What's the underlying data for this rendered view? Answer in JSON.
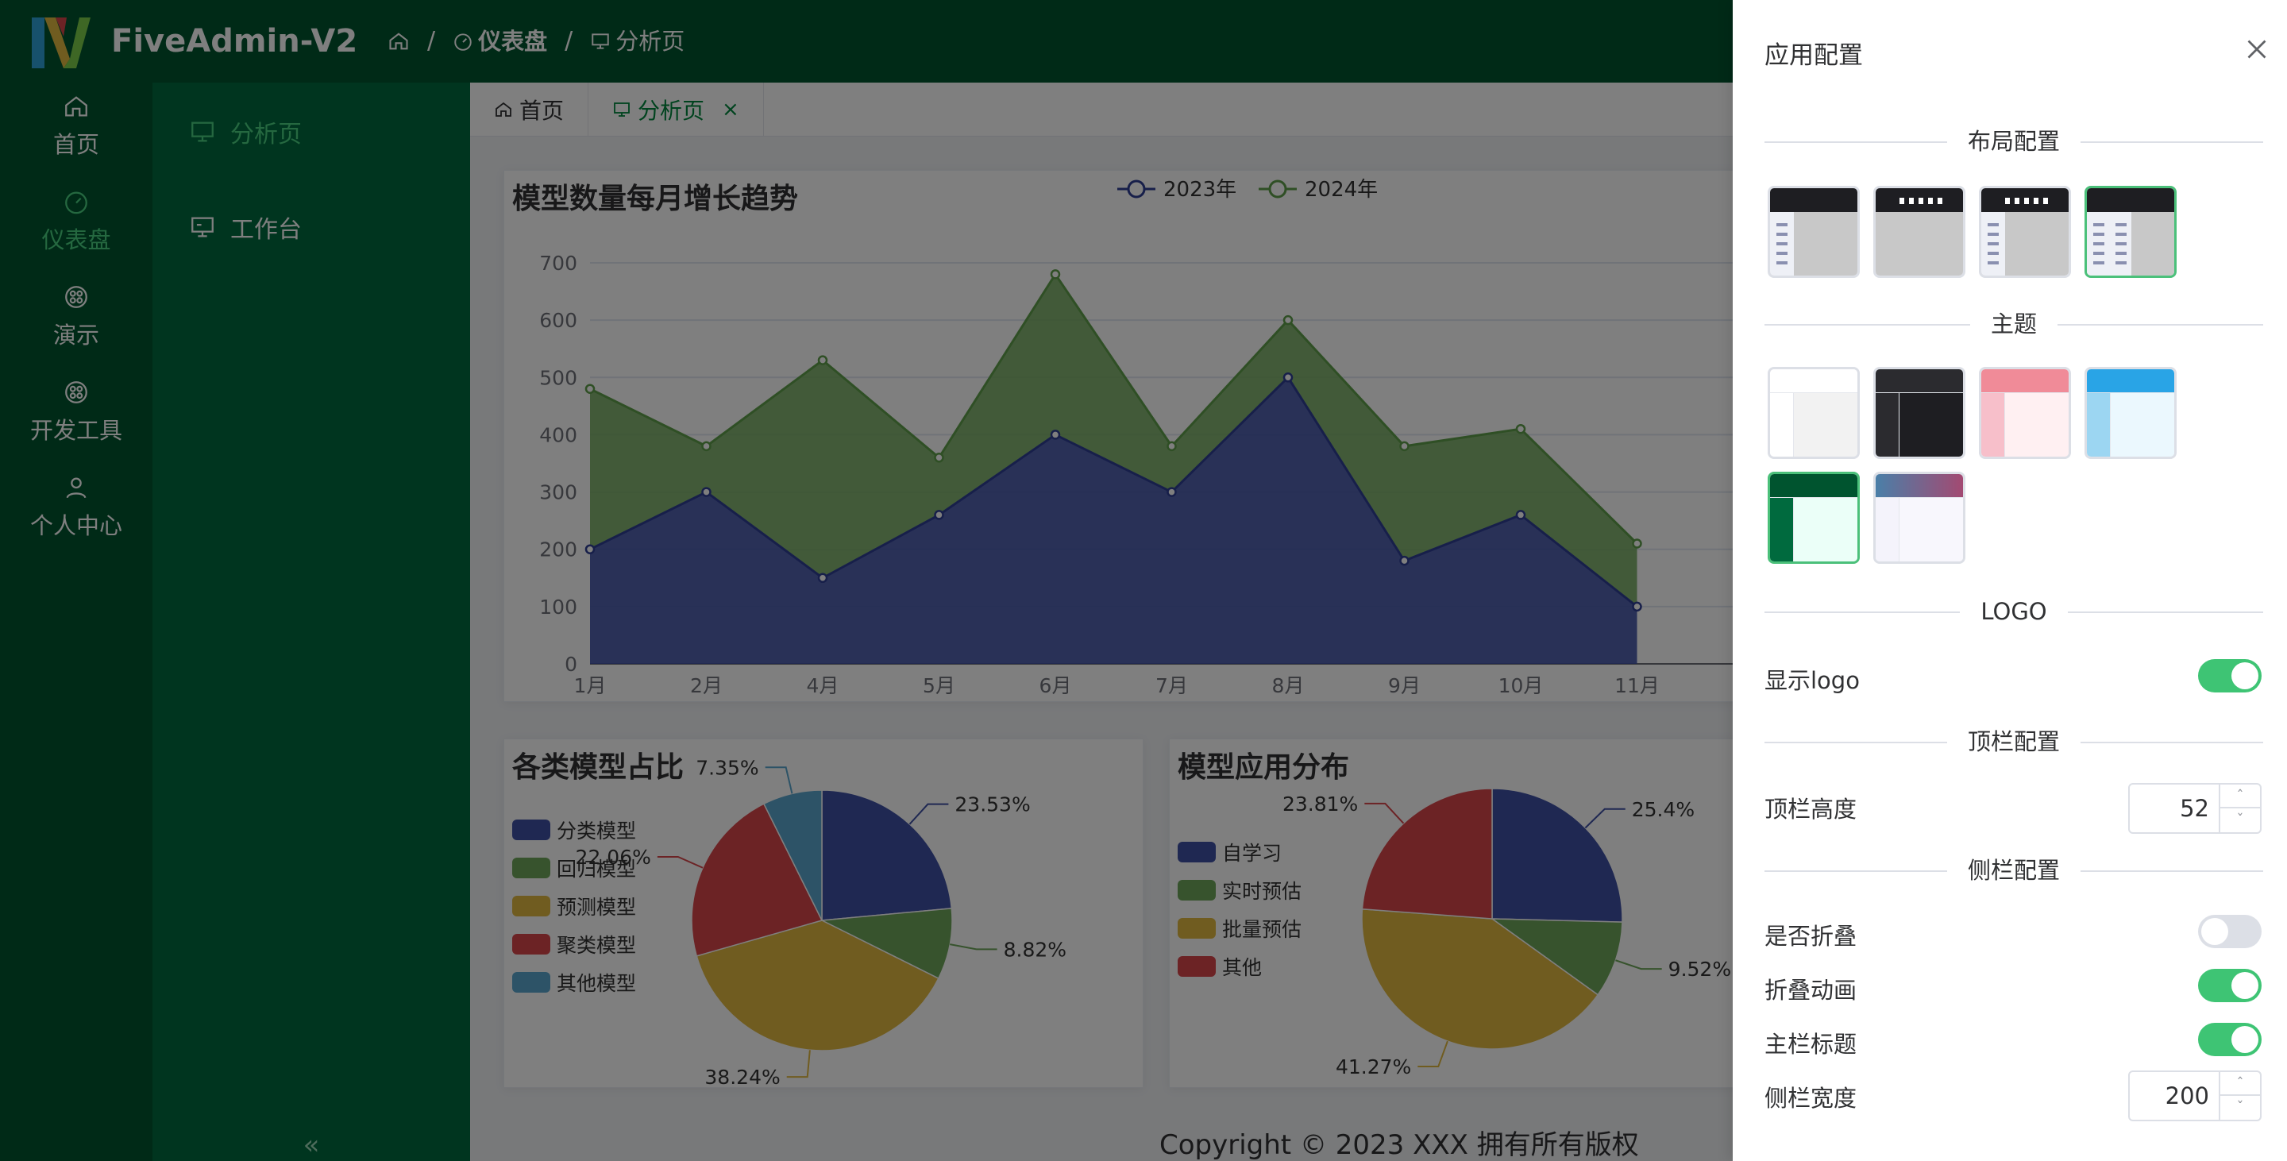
{
  "app": {
    "name": "FiveAdmin-V2"
  },
  "breadcrumb": {
    "home_icon": "home-icon",
    "items": [
      {
        "icon": "dashboard-icon",
        "label": "仪表盘"
      },
      {
        "icon": "presentation-icon",
        "label": "分析页"
      }
    ],
    "separator": "/"
  },
  "primary_nav": [
    {
      "label": "首页",
      "icon": "home-icon"
    },
    {
      "label": "仪表盘",
      "icon": "dashboard-icon",
      "active": true
    },
    {
      "label": "演示",
      "icon": "grid-icon"
    },
    {
      "label": "开发工具",
      "icon": "grid-icon"
    },
    {
      "label": "个人中心",
      "icon": "user-icon"
    }
  ],
  "secondary_nav": [
    {
      "label": "分析页",
      "icon": "presentation-icon",
      "active": true
    },
    {
      "label": "工作台",
      "icon": "monitor-icon"
    }
  ],
  "collapse_glyph": "«",
  "tabs": [
    {
      "label": "首页",
      "icon": "home-icon"
    },
    {
      "label": "分析页",
      "icon": "presentation-icon",
      "active": true,
      "close": "×"
    }
  ],
  "colors": {
    "primary": "#00542f",
    "sidebar": "#006a3e",
    "accent": "#3ec474",
    "series_2023": "#3f51a5",
    "series_2024": "#6ea75b"
  },
  "chart_data": [
    {
      "type": "area",
      "title": "模型数量每月增长趋势",
      "categories": [
        "1月",
        "2月",
        "4月",
        "5月",
        "6月",
        "7月",
        "8月",
        "9月",
        "10月",
        "11月"
      ],
      "series": [
        {
          "name": "2023年",
          "values": [
            200,
            300,
            150,
            260,
            400,
            300,
            500,
            180,
            260,
            100
          ]
        },
        {
          "name": "2024年",
          "values": [
            480,
            380,
            530,
            360,
            680,
            380,
            600,
            380,
            410,
            210
          ]
        }
      ],
      "yticks": [
        "0",
        "100",
        "200",
        "300",
        "400",
        "500",
        "600",
        "700"
      ],
      "ylim": [
        0,
        700
      ],
      "legend": "top-center",
      "grid": true
    },
    {
      "type": "pie",
      "title": "各类模型占比",
      "slices": [
        {
          "name": "分类模型",
          "value": 23.53,
          "label": "23.53%",
          "color": "#3f51a5"
        },
        {
          "name": "回归模型",
          "value": 8.82,
          "label": "8.82%",
          "color": "#6ea75b"
        },
        {
          "name": "预测模型",
          "value": 38.24,
          "label": "38.24%",
          "color": "#e0b840"
        },
        {
          "name": "聚类模型",
          "value": 22.06,
          "label": "22.06%",
          "color": "#d9464b"
        },
        {
          "name": "其他模型",
          "value": 7.35,
          "label": "7.35%",
          "color": "#5aa7cf"
        }
      ],
      "legend": "left"
    },
    {
      "type": "pie",
      "title": "模型应用分布",
      "slices": [
        {
          "name": "自学习",
          "value": 25.4,
          "label": "25.4%",
          "color": "#3f51a5"
        },
        {
          "name": "实时预估",
          "value": 9.52,
          "label": "9.52%",
          "color": "#6ea75b"
        },
        {
          "name": "批量预估",
          "value": 41.27,
          "label": "41.27%",
          "color": "#e0b840"
        },
        {
          "name": "其他",
          "value": 23.81,
          "label": "23.81%",
          "color": "#d9464b"
        }
      ],
      "legend": "left"
    }
  ],
  "footer": {
    "copyright": "Copyright © 2023 XXX 拥有所有版权"
  },
  "drawer": {
    "title": "应用配置",
    "close_icon": "close-icon",
    "sections": {
      "layout": "布局配置",
      "theme": "主题",
      "logo": "LOGO",
      "topbar": "顶栏配置",
      "sidebar": "侧栏配置"
    },
    "layouts": [
      "top-side-layout",
      "top-menu-layout",
      "mixed-layout",
      "dual-side-layout"
    ],
    "selected_layout": 3,
    "themes": [
      {
        "name": "light",
        "header": "#ffffff",
        "side": "#ffffff",
        "body": "#f2f2f2"
      },
      {
        "name": "dark",
        "header": "#2b2b2f",
        "side": "#2b2b2f",
        "body": "#1e1e22"
      },
      {
        "name": "pink",
        "header": "#f08b98",
        "side": "#f7bfca",
        "body": "#fff0f2"
      },
      {
        "name": "blue",
        "header": "#29a4e6",
        "side": "#9cd6f2",
        "body": "#ebf8fe"
      },
      {
        "name": "green",
        "header": "#00542f",
        "side": "#006a3e",
        "body": "#ebfff8"
      },
      {
        "name": "gradient",
        "header": "#6a5f9e",
        "side": "#f4f3fb",
        "body": "#f8f7fd"
      }
    ],
    "selected_theme": 4,
    "show_logo": {
      "label": "显示logo",
      "value": true
    },
    "topbar_height": {
      "label": "顶栏高度",
      "value": "52",
      "up": "ˆ",
      "down": "ˇ"
    },
    "sidebar_collapse": {
      "label": "是否折叠",
      "value": false
    },
    "collapse_animation": {
      "label": "折叠动画",
      "value": true
    },
    "main_title": {
      "label": "主栏标题",
      "value": true
    },
    "sidebar_width": {
      "label": "侧栏宽度",
      "value": "200",
      "up": "ˆ",
      "down": "ˇ"
    }
  }
}
